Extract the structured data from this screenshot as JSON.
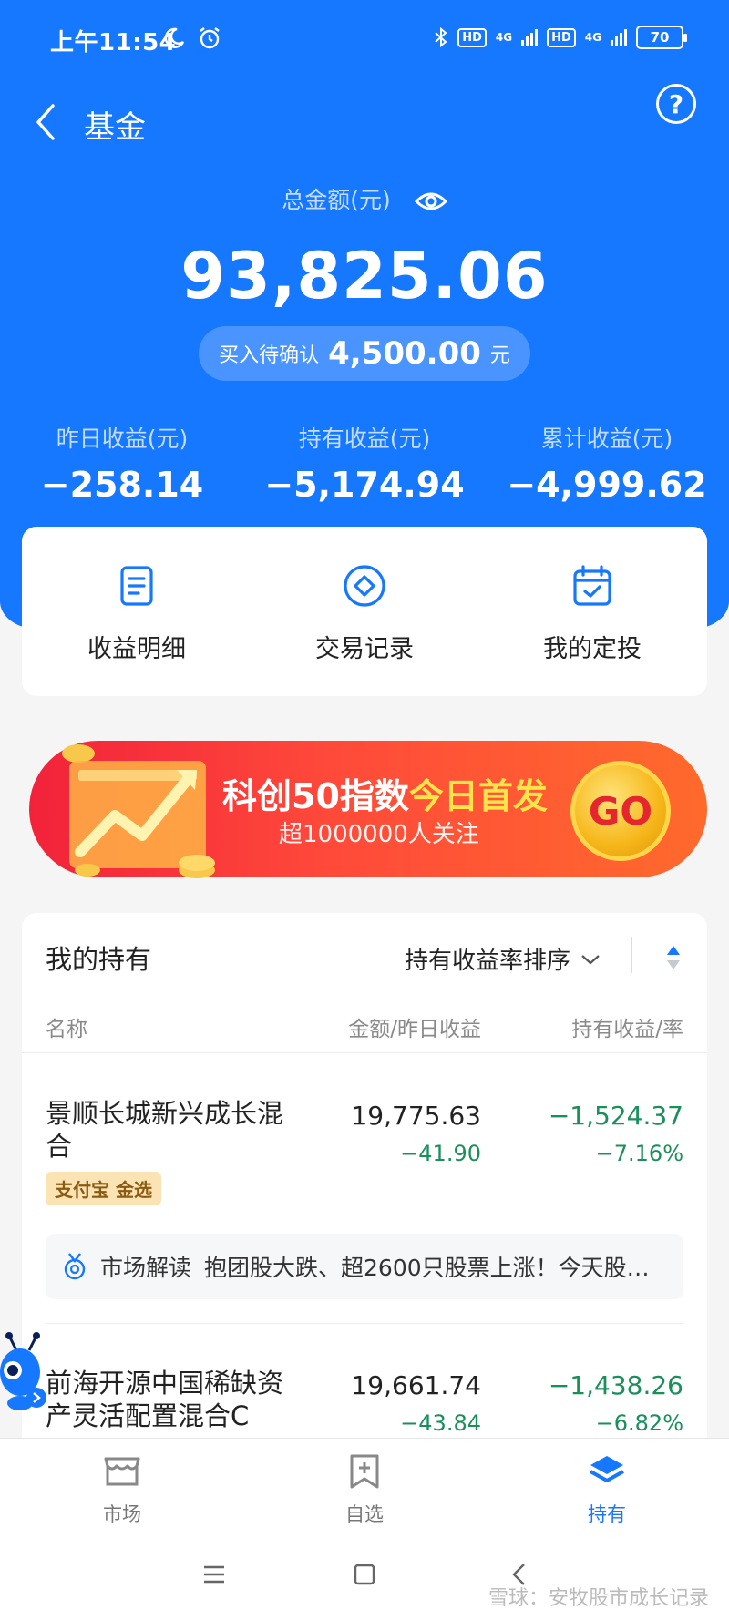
{
  "status_bar": {
    "time": "上午11:54",
    "hd1": "HD",
    "net1": "4G",
    "hd2": "HD",
    "net2": "4G",
    "battery": "70"
  },
  "nav": {
    "title": "基金",
    "help": "?"
  },
  "summary": {
    "total_label": "总金额(元)",
    "total_amount": "93,825.06",
    "pending_label": "买入待确认",
    "pending_amount": "4,500.00",
    "pending_unit": "元",
    "stats": [
      {
        "label": "昨日收益(元)",
        "value": "−258.14"
      },
      {
        "label": "持有收益(元)",
        "value": "−5,174.94"
      },
      {
        "label": "累计收益(元)",
        "value": "−4,999.62"
      }
    ]
  },
  "actions": [
    {
      "label": "收益明细",
      "icon": "document-icon"
    },
    {
      "label": "交易记录",
      "icon": "diamond-circle-icon"
    },
    {
      "label": "我的定投",
      "icon": "calendar-check-icon"
    }
  ],
  "banner": {
    "title_main": "科创50指数",
    "title_highlight": "今日首发",
    "subtitle": "超1000000人关注",
    "button": "GO"
  },
  "holdings": {
    "title": "我的持有",
    "sort_label": "持有收益率排序",
    "columns": {
      "name": "名称",
      "amount": "金额/昨日收益",
      "pl": "持有收益/率"
    },
    "funds": [
      {
        "name": "景顺长城新兴成长混合",
        "amount": "19,775.63",
        "yesterday": "−41.90",
        "pl": "−1,524.37",
        "rate": "−7.16%",
        "tag": "支付宝 金选",
        "insight_keyword": "市场解读",
        "insight_text": "抱团股大跌、超2600只股票上涨！今天股…"
      },
      {
        "name": "前海开源中国稀缺资产灵活配置混合C",
        "amount": "19,661.74",
        "yesterday": "−43.84",
        "pl": "−1,438.26",
        "rate": "−6.82%"
      }
    ]
  },
  "tabbar": [
    {
      "label": "市场",
      "icon": "shop-icon",
      "active": false
    },
    {
      "label": "自选",
      "icon": "bookmark-add-icon",
      "active": false
    },
    {
      "label": "持有",
      "icon": "layers-icon",
      "active": true
    }
  ],
  "watermark": "雪球：安牧股市成长记录",
  "colors": {
    "primary_blue": "#1677ff",
    "loss_green": "#1a8f5a",
    "banner_red": "#f2223a",
    "highlight_yellow": "#ffe34a"
  }
}
